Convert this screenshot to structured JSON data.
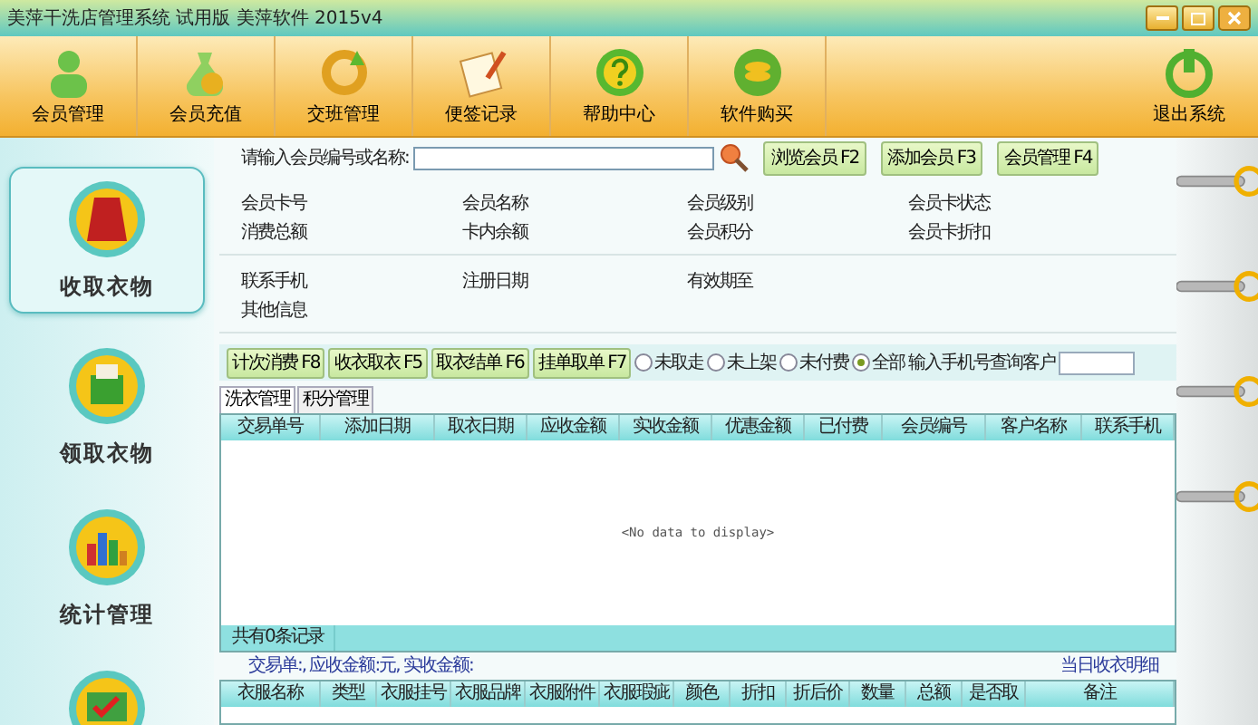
{
  "window": {
    "title": "美萍干洗店管理系统 试用版 美萍软件  2015v4"
  },
  "toolbar": [
    {
      "label": "会员管理",
      "kind": "person"
    },
    {
      "label": "会员充值",
      "kind": "coins"
    },
    {
      "label": "交班管理",
      "kind": "cycle"
    },
    {
      "label": "便签记录",
      "kind": "note"
    },
    {
      "label": "帮助中心",
      "kind": "help"
    },
    {
      "label": "软件购买",
      "kind": "stack"
    }
  ],
  "exit": {
    "label": "退出系统"
  },
  "sidebar": [
    {
      "label": "收取衣物",
      "kind": "coat",
      "selected": true
    },
    {
      "label": "领取衣物",
      "kind": "box",
      "selected": false
    },
    {
      "label": "统计管理",
      "kind": "chart",
      "selected": false
    },
    {
      "kind": "check",
      "selected": false
    }
  ],
  "search": {
    "label": "请输入会员编号或名称:",
    "buttons": [
      "浏览会员 F2",
      "添加会员 F3",
      "会员管理 F4"
    ]
  },
  "member_info": [
    [
      "会员卡号",
      "会员名称",
      "会员级别",
      "会员卡状态"
    ],
    [
      "消费总额",
      "卡内余额",
      "会员积分",
      "会员卡折扣"
    ]
  ],
  "contact_info": [
    [
      "联系手机",
      "注册日期",
      "有效期至"
    ],
    [
      "其他信息"
    ]
  ],
  "actions": [
    "计次消费 F8",
    "收衣取衣 F5",
    "取衣结单 F6",
    "挂单取单 F7"
  ],
  "filters": [
    {
      "label": "未取走",
      "selected": false
    },
    {
      "label": "未上架",
      "selected": false
    },
    {
      "label": "未付费",
      "selected": false
    },
    {
      "label": "全部",
      "selected": true
    }
  ],
  "phone_search": {
    "label": "输入手机号查询客户"
  },
  "tabs": [
    {
      "label": "洗衣管理",
      "selected": true
    },
    {
      "label": "积分管理",
      "selected": false
    }
  ],
  "orders_table": {
    "columns": [
      "交易单号",
      "添加日期",
      "取衣日期",
      "应收金额",
      "实收金额",
      "优惠金额",
      "已付费",
      "会员编号",
      "客户名称",
      "联系手机"
    ],
    "empty_text": "<No data to display>",
    "footer": "共有0条记录"
  },
  "summary": {
    "text": "交易单:, 应收金额:元, 实收金额:",
    "link": "当日收衣明细"
  },
  "items_table": {
    "columns": [
      "衣服名称",
      "类型",
      "衣服挂号",
      "衣服品牌",
      "衣服附件",
      "衣服瑕疵",
      "颜色",
      "折扣",
      "折后价",
      "数量",
      "总额",
      "是否取",
      "备注"
    ]
  }
}
